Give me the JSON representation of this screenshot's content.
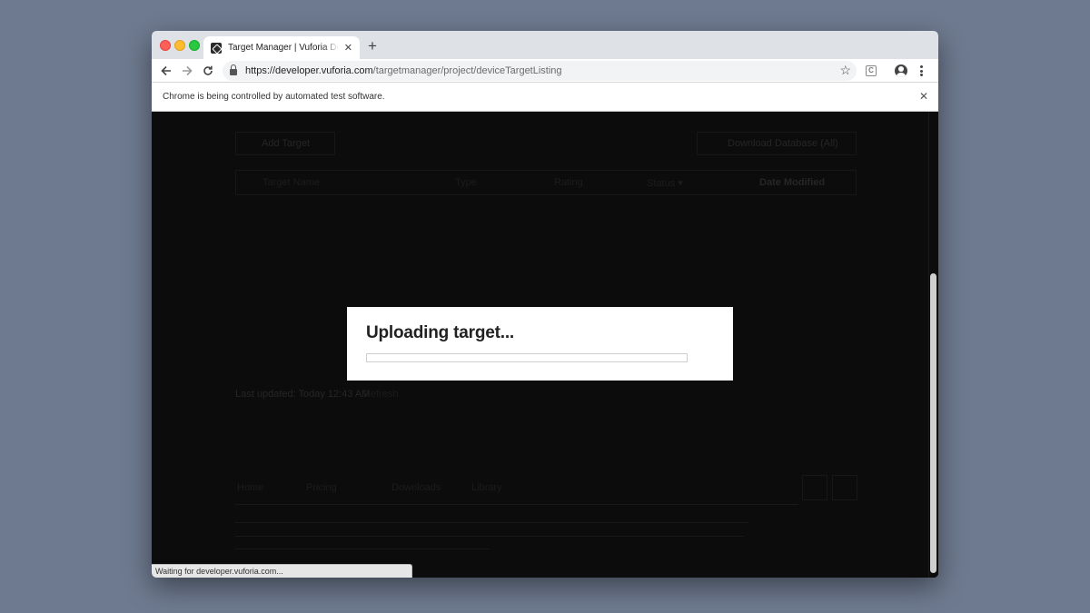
{
  "browser": {
    "tab_title": "Target Manager | Vuforia Developer Portal",
    "url_host": "https://developer.vuforia.com",
    "url_path": "/targetmanager/project/deviceTargetListing",
    "infobar_text": "Chrome is being controlled by automated test software.",
    "status_text": "Waiting for developer.vuforia.com...",
    "new_tab_glyph": "+",
    "tab_close_glyph": "✕",
    "infobar_close_glyph": "✕"
  },
  "page": {
    "add_target_label": "Add Target",
    "download_label": "Download Database (All)",
    "table_headers": [
      "Target Name",
      "Type",
      "Rating",
      "Status ▾",
      "Date Modified"
    ],
    "last_updated_label": "Last updated: Today 12:43 AM",
    "refresh_label": "Refresh",
    "footer_links": [
      "Home",
      "Pricing",
      "Downloads",
      "Library"
    ]
  },
  "modal": {
    "title": "Uploading target...",
    "progress": 0.0
  },
  "icons": {
    "back": "back-arrow-icon",
    "forward": "forward-arrow-icon",
    "reload": "reload-icon",
    "lock": "lock-icon",
    "star": "bookmark-star-icon",
    "extension": "extension-icon",
    "profile": "profile-icon",
    "menu": "kebab-menu-icon"
  }
}
